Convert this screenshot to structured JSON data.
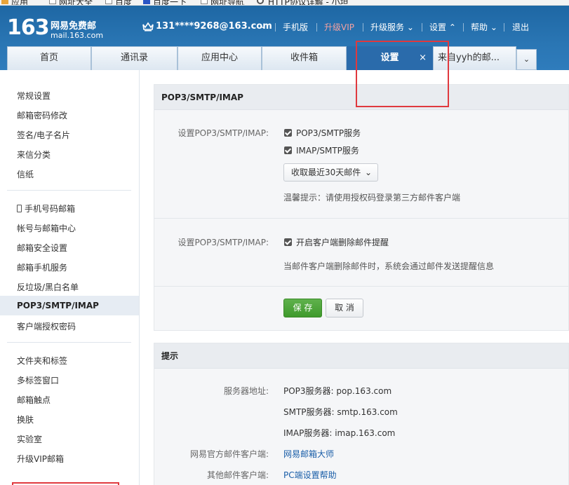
{
  "bookmarks": [
    "应用",
    "网址大全",
    "百度",
    "百度一下",
    "网址导航",
    "HTTP协议详解 - 小坦"
  ],
  "header": {
    "logo_number": "163",
    "logo_cn": "网易免费邮",
    "logo_domain": "mail.163.com",
    "account": "131****9268@163.com",
    "nav": [
      "手机版",
      "升级VIP",
      "升级服务",
      "设置",
      "帮助",
      "退出"
    ]
  },
  "tabs": [
    {
      "label": "首页"
    },
    {
      "label": "通讯录"
    },
    {
      "label": "应用中心"
    },
    {
      "label": "收件箱"
    },
    {
      "label": "设置",
      "close": "×"
    },
    {
      "label": "来自yyh的邮..."
    }
  ],
  "sidebar": {
    "group1": [
      "常规设置",
      "邮箱密码修改",
      "签名/电子名片",
      "来信分类",
      "信纸"
    ],
    "group2": [
      "手机号码邮箱",
      "帐号与邮箱中心",
      "邮箱安全设置",
      "邮箱手机服务",
      "反垃圾/黑白名单",
      "POP3/SMTP/IMAP",
      "客户端授权密码"
    ],
    "group3": [
      "文件夹和标签",
      "多标签窗口",
      "邮箱触点",
      "换肤",
      "实验室",
      "升级VIP邮箱"
    ]
  },
  "settings": {
    "title": "POP3/SMTP/IMAP",
    "row1_label": "设置POP3/SMTP/IMAP:",
    "pop3_smtp": "POP3/SMTP服务",
    "imap_smtp": "IMAP/SMTP服务",
    "receive_select": "收取最近30天邮件",
    "tip": "温馨提示：请使用授权码登录第三方邮件客户端",
    "row2_label": "设置POP3/SMTP/IMAP:",
    "delete_alert": "开启客户端删除邮件提醒",
    "delete_desc": "当邮件客户端删除邮件时，系统会通过邮件发送提醒信息",
    "save": "保 存",
    "cancel": "取 消"
  },
  "hints": {
    "title": "提示",
    "server_label": "服务器地址:",
    "pop3": "POP3服务器: pop.163.com",
    "smtp": "SMTP服务器: smtp.163.com",
    "imap": "IMAP服务器: imap.163.com",
    "official_label": "网易官方邮件客户端:",
    "official_link": "网易邮箱大师",
    "other_label": "其他邮件客户端:",
    "other_link": "PC端设置帮助"
  }
}
